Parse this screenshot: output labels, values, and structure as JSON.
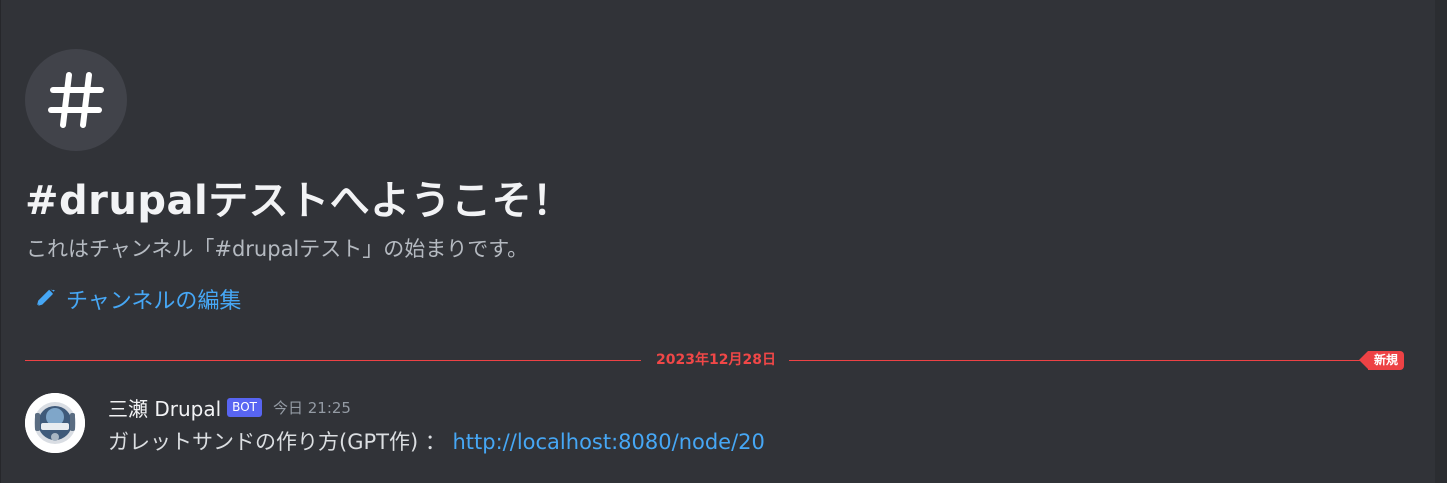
{
  "welcome": {
    "title": "#drupalテストへようこそ！",
    "description": "これはチャンネル「#drupalテスト」の始まりです。",
    "edit_channel_label": "チャンネルの編集"
  },
  "divider": {
    "date": "2023年12月28日",
    "new_badge": "新規"
  },
  "message": {
    "author": "三瀬 Drupal",
    "bot_tag": "BOT",
    "timestamp": "今日 21:25",
    "text": "ガレットサンドの作り方(GPT作) ： ",
    "link": "http://localhost:8080/node/20"
  },
  "colors": {
    "background": "#313338",
    "link": "#46a7f5",
    "new_divider": "#ed4245",
    "bot_tag": "#5865f2"
  },
  "icons": {
    "channel": "hash-icon",
    "edit": "pencil-icon",
    "avatar": "bot-avatar"
  }
}
